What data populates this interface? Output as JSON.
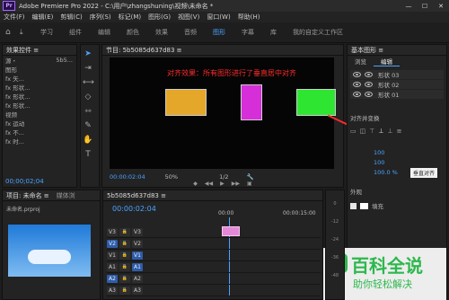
{
  "window": {
    "title": "Adobe Premiere Pro 2022 - C:\\用户\\zhangshuning\\视频\\未命名 *",
    "logo": "Pr",
    "min": "—",
    "max": "☐",
    "close": "✕"
  },
  "menu": [
    "文件(F)",
    "编辑(E)",
    "剪辑(C)",
    "序列(S)",
    "标记(M)",
    "图形(G)",
    "视图(V)",
    "窗口(W)",
    "帮助(H)"
  ],
  "workspaces": [
    {
      "label": "学习",
      "active": false
    },
    {
      "label": "组件",
      "active": false
    },
    {
      "label": "编辑",
      "active": false
    },
    {
      "label": "颜色",
      "active": false
    },
    {
      "label": "效果",
      "active": false
    },
    {
      "label": "音频",
      "active": false
    },
    {
      "label": "图形",
      "active": true
    },
    {
      "label": "字幕",
      "active": false
    },
    {
      "label": "库",
      "active": false
    },
    {
      "label": "我的自定义工作区",
      "active": false
    }
  ],
  "effects_panel": {
    "title": "效果控件 ≡",
    "source": "源・",
    "clip": "5b5...",
    "section_graphics": "图形",
    "rows": [
      "fx 矢...",
      "fx 形状...",
      "fx 形状...",
      "fx 形状..."
    ],
    "section_video": "视频",
    "rows2": [
      "fx 运动",
      "fx 不...",
      "fx 时..."
    ],
    "timecode": "00;00;02;04"
  },
  "program_monitor": {
    "title": "节目: 5b5085d637d83 ≡",
    "annotation": "对齐效果：所有图形进行了垂直居中对齐",
    "timecode": "00:00:02:04",
    "zoom": "50%",
    "quality": "1/2",
    "colors": {
      "shape1": "#e4a72a",
      "shape2": "#d62ed9",
      "shape3": "#2ee632"
    }
  },
  "essential_graphics": {
    "title": "基本图形 ≡",
    "tabs": [
      "浏览",
      "编辑"
    ],
    "active_tab": "编辑",
    "layers": [
      "形状 03",
      "形状 02",
      "形状 01"
    ],
    "align_label": "对齐并变换",
    "tooltip": "垂直对齐",
    "values": [
      "100",
      "100",
      "100.0 %"
    ],
    "appearance": "外观",
    "fill_label": "填充",
    "footer": "助你轻松解决",
    "footer_big": "百科全说"
  },
  "project_panel": {
    "title": "项目: 未命名 ≡",
    "tab2": "媒体浏",
    "file": "未命名.prproj",
    "icon": "cloud-thumbnail"
  },
  "timeline": {
    "title": "5b5085d637d83 ≡",
    "timecode": "00:00:02:04",
    "ruler": [
      "00:00",
      "00:00:15:00"
    ],
    "tracks": [
      {
        "name": "V3",
        "lbl": "V3"
      },
      {
        "name": "V2",
        "lbl": "V2"
      },
      {
        "name": "V1",
        "lbl": "V1"
      },
      {
        "name": "A1",
        "lbl": "A1"
      },
      {
        "name": "A2",
        "lbl": "A2"
      },
      {
        "name": "A3",
        "lbl": "A3"
      }
    ],
    "meters": [
      "0",
      "-12",
      "-24",
      "-36",
      "-48"
    ]
  }
}
